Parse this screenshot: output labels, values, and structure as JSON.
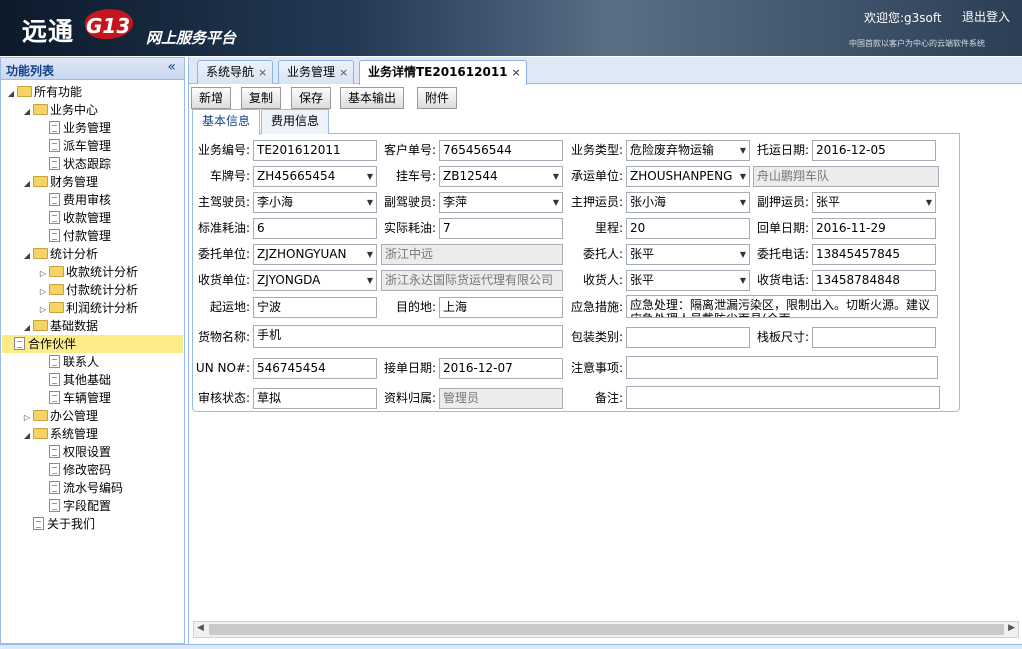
{
  "header": {
    "logo": "远通",
    "g3": "G13",
    "subtitle": "网上服务平台",
    "welcome": "欢迎您:g3soft",
    "logout": "退出登入",
    "slogan": "中国首款以客户为中心的云端软件系统"
  },
  "sidebar": {
    "title": "功能列表",
    "collapse": "«",
    "items": [
      {
        "label": "所有功能",
        "level": 0,
        "type": "folder",
        "arrow": "◢"
      },
      {
        "label": "业务中心",
        "level": 1,
        "type": "folder",
        "arrow": "◢"
      },
      {
        "label": "业务管理",
        "level": 2,
        "type": "doc"
      },
      {
        "label": "派车管理",
        "level": 2,
        "type": "doc"
      },
      {
        "label": "状态跟踪",
        "level": 2,
        "type": "doc"
      },
      {
        "label": "财务管理",
        "level": 1,
        "type": "folder",
        "arrow": "◢"
      },
      {
        "label": "费用审核",
        "level": 2,
        "type": "doc"
      },
      {
        "label": "收款管理",
        "level": 2,
        "type": "doc"
      },
      {
        "label": "付款管理",
        "level": 2,
        "type": "doc"
      },
      {
        "label": "统计分析",
        "level": 1,
        "type": "folder",
        "arrow": "◢"
      },
      {
        "label": "收款统计分析",
        "level": 2,
        "type": "folder",
        "arrow": "▷"
      },
      {
        "label": "付款统计分析",
        "level": 2,
        "type": "folder",
        "arrow": "▷"
      },
      {
        "label": "利润统计分析",
        "level": 2,
        "type": "folder",
        "arrow": "▷"
      },
      {
        "label": "基础数据",
        "level": 1,
        "type": "folder",
        "arrow": "◢"
      },
      {
        "label": "合作伙伴",
        "level": 2,
        "type": "doc",
        "selected": true
      },
      {
        "label": "联系人",
        "level": 2,
        "type": "doc"
      },
      {
        "label": "其他基础",
        "level": 2,
        "type": "doc"
      },
      {
        "label": "车辆管理",
        "level": 2,
        "type": "doc"
      },
      {
        "label": "办公管理",
        "level": 1,
        "type": "folder",
        "arrow": "▷"
      },
      {
        "label": "系统管理",
        "level": 1,
        "type": "folder",
        "arrow": "◢"
      },
      {
        "label": "权限设置",
        "level": 2,
        "type": "doc"
      },
      {
        "label": "修改密码",
        "level": 2,
        "type": "doc"
      },
      {
        "label": "流水号编码",
        "level": 2,
        "type": "doc"
      },
      {
        "label": "字段配置",
        "level": 2,
        "type": "doc"
      },
      {
        "label": "关于我们",
        "level": 1,
        "type": "doc"
      }
    ]
  },
  "tabs": [
    {
      "label": "系统导航",
      "close": "×"
    },
    {
      "label": "业务管理",
      "close": "×"
    },
    {
      "label": "业务详情TE201612011",
      "close": "×",
      "active": true
    }
  ],
  "toolbar": [
    "新增",
    "复制",
    "保存",
    "基本输出",
    "附件"
  ],
  "subtabs": [
    {
      "label": "基本信息",
      "active": true
    },
    {
      "label": "费用信息"
    }
  ],
  "form": {
    "business_no_label": "业务编号:",
    "business_no": "TE201612011",
    "customer_no_label": "客户单号:",
    "customer_no": "765456544",
    "business_type_label": "业务类型:",
    "business_type": "危险废弃物运输",
    "ship_date_label": "托运日期:",
    "ship_date": "2016-12-05",
    "plate_label": "车牌号:",
    "plate": "ZH45665454",
    "trailer_label": "挂车号:",
    "trailer": "ZB12544",
    "carrier_label": "承运单位:",
    "carrier": "ZHOUSHANPENG",
    "carrier_name": "舟山鹏翔车队",
    "main_driver_label": "主驾驶员:",
    "main_driver": "李小海",
    "co_driver_label": "副驾驶员:",
    "co_driver": "李萍",
    "main_escort_label": "主押运员:",
    "main_escort": "张小海",
    "co_escort_label": "副押运员:",
    "co_escort": "张平",
    "std_fuel_label": "标准耗油:",
    "std_fuel": "6",
    "actual_fuel_label": "实际耗油:",
    "actual_fuel": "7",
    "mileage_label": "里程:",
    "mileage": "20",
    "return_date_label": "回单日期:",
    "return_date": "2016-11-29",
    "consignor_label": "委托单位:",
    "consignor": "ZJZHONGYUAN",
    "consignor_name": "浙江中远",
    "client_label": "委托人:",
    "client": "张平",
    "client_phone_label": "委托电话:",
    "client_phone": "13845457845",
    "receiver_unit_label": "收货单位:",
    "receiver_unit": "ZJYONGDA",
    "receiver_unit_name": "浙江永达国际货运代理有限公司",
    "receiver_label": "收货人:",
    "receiver": "张平",
    "receiver_phone_label": "收货电话:",
    "receiver_phone": "13458784848",
    "origin_label": "起运地:",
    "origin": "宁波",
    "dest_label": "目的地:",
    "dest": "上海",
    "emergency_label": "应急措施:",
    "emergency": "应急处理：隔离泄漏污染区，限制出入。切断火源。建议应急处理人员戴防尘面具(全面",
    "goods_label": "货物名称:",
    "goods": "手机",
    "packing_label": "包装类别:",
    "packing": "",
    "plate_size_label": "栈板尺寸:",
    "plate_size": "",
    "un_label": "UN NO#:",
    "un": "546745454",
    "receive_date_label": "接单日期:",
    "receive_date": "2016-12-07",
    "notes_label": "注意事项:",
    "notes": "",
    "audit_label": "审核状态:",
    "audit": "草拟",
    "owner_label": "资料归属:",
    "owner": "管理员",
    "remark_label": "备注:",
    "remark": ""
  }
}
